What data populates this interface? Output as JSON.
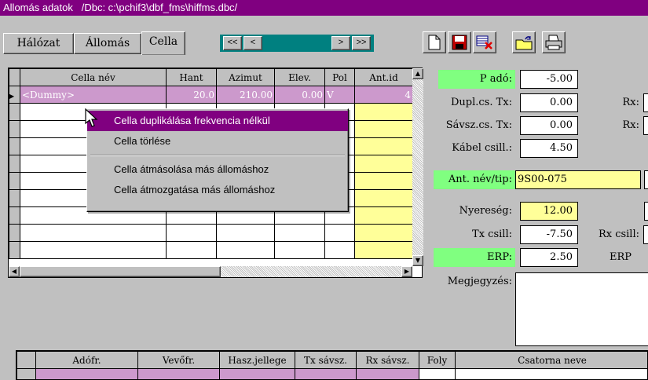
{
  "window": {
    "title": "Allomás adatok   /Dbc: c:\\pchif3\\dbf_fms\\hiffms.dbc/"
  },
  "tabs": [
    {
      "label": "Hálózat"
    },
    {
      "label": "Állomás"
    },
    {
      "label": "Cella"
    }
  ],
  "nav": {
    "first": "<<",
    "prev": "<",
    "next": ">",
    "last": ">>"
  },
  "toolbar": {
    "new": "new-icon",
    "save": "save-icon",
    "delete": "delete-icon",
    "open": "open-icon",
    "print": "printer-icon"
  },
  "cell_table": {
    "headers": [
      "Cella név",
      "Hant",
      "Azimut",
      "Elev.",
      "Pol",
      "Ant.id"
    ],
    "rows": [
      [
        "<Dummy>",
        "20.0",
        "210.00",
        "0.00",
        "V",
        "4"
      ]
    ]
  },
  "context_menu": {
    "items": [
      "Cella duplikálása frekvencia nélkül",
      "Cella törlése",
      "Cella átmásolása más állomáshoz",
      "Cella átmozgatása más állomáshoz"
    ]
  },
  "params": {
    "p_ado": {
      "label": "P adó:",
      "value": "-5.00"
    },
    "dupl_tx": {
      "label": "Dupl.cs. Tx:",
      "value": "0.00",
      "rx_label": "Rx:"
    },
    "savsz_tx": {
      "label": "Sávsz.cs. Tx:",
      "value": "0.00",
      "rx_label": "Rx:"
    },
    "kabel": {
      "label": "Kábel csill.:",
      "value": "4.50"
    },
    "ant_nev": {
      "label": "Ant. név/tip:",
      "value": "9S00-075"
    },
    "nyereseg": {
      "label": "Nyereség:",
      "value": "12.00"
    },
    "tx_csill": {
      "label": "Tx csill:",
      "value": "-7.50",
      "rx_label": "Rx csill:"
    },
    "erp": {
      "label": "ERP:",
      "value": "2.50",
      "erp_label": "ERP"
    },
    "megjegyzes": {
      "label": "Megjegyzés:"
    }
  },
  "freq_table": {
    "headers": [
      "Adófr.",
      "Vevőfr.",
      "Hasz.jellege",
      "Tx sávsz.",
      "Rx sávsz.",
      "Foly",
      "Csatorna neve"
    ]
  },
  "colors": {
    "title_bar": "#800080",
    "highlight": "#800080",
    "selected_row": "#cc99cc",
    "green_label": "#80ff80",
    "yellow_field": "#ffff99"
  }
}
